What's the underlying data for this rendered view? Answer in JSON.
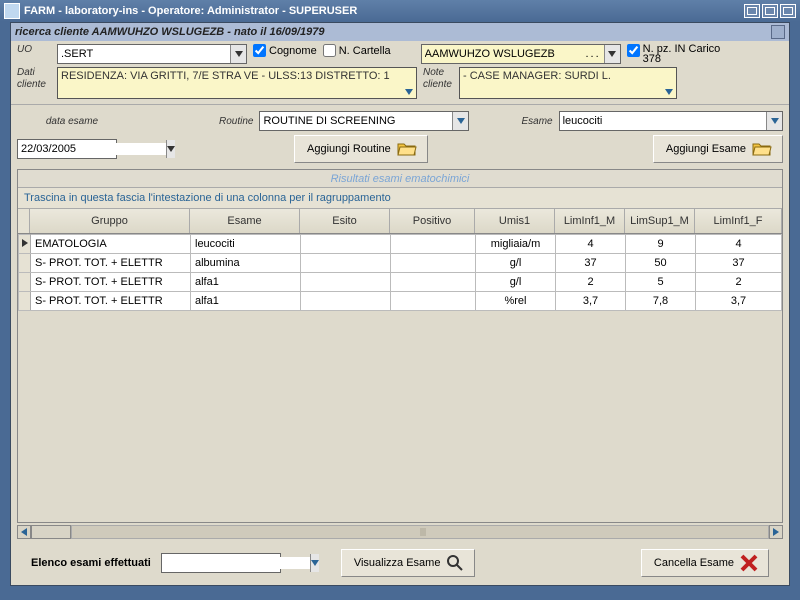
{
  "title": "FARM - laboratory-ins - Operatore: Administrator -  SUPERUSER",
  "subhead": "ricerca cliente  AAMWUHZO WSLUGEZB - nato il 16/09/1979",
  "form": {
    "uo_label": "UO",
    "uo_value": ".SERT",
    "cognome_label": "Cognome",
    "ncartella_label": "N. Cartella",
    "client_combo": "AAMWUHZO WSLUGEZB",
    "client_ellipsis": "...",
    "npz_label": "N. pz. IN Carico",
    "npz_count": "378",
    "dati_cliente_label1": "Dati",
    "dati_cliente_label2": "cliente",
    "dati_cliente_text": "RESIDENZA: VIA GRITTI, 7/E STRA VE  - ULSS:13  DISTRETTO: 1",
    "note_cliente_label1": "Note",
    "note_cliente_label2": "cliente",
    "note_cliente_text": "- CASE MANAGER: SURDI L."
  },
  "mid": {
    "data_esame_label": "data esame",
    "data_esame_value": "22/03/2005",
    "routine_label": "Routine",
    "routine_value": "ROUTINE DI SCREENING",
    "aggiungi_routine": "Aggiungi Routine",
    "esame_label": "Esame",
    "esame_value": "leucociti",
    "aggiungi_esame": "Aggiungi Esame"
  },
  "grid": {
    "title": "Risultati esami ematochimici",
    "grouphint": "Trascina in questa fascia l'intestazione di una colonna per il ragruppamento",
    "cols": [
      "Gruppo",
      "Esame",
      "Esito",
      "Positivo",
      "Umis1",
      "LimInf1_M",
      "LimSup1_M",
      "LimInf1_F"
    ],
    "rows": [
      {
        "g": "EMATOLOGIA",
        "e": "leucociti",
        "esito": "",
        "pos": "",
        "u": "migliaia/m",
        "li": "4",
        "ls": "9",
        "lf": "4",
        "ptr": true
      },
      {
        "g": "S- PROT. TOT. + ELETTR",
        "e": "albumina",
        "esito": "",
        "pos": "",
        "u": "g/l",
        "li": "37",
        "ls": "50",
        "lf": "37"
      },
      {
        "g": "S- PROT. TOT. + ELETTR",
        "e": "alfa1",
        "esito": "",
        "pos": "",
        "u": "g/l",
        "li": "2",
        "ls": "5",
        "lf": "2"
      },
      {
        "g": "S- PROT. TOT. + ELETTR",
        "e": "alfa1",
        "esito": "",
        "pos": "",
        "u": "%rel",
        "li": "3,7",
        "ls": "7,8",
        "lf": "3,7"
      }
    ]
  },
  "footer": {
    "elenco_label": "Elenco esami effettuati",
    "visualizza": "Visualizza Esame",
    "cancella": "Cancella Esame"
  }
}
